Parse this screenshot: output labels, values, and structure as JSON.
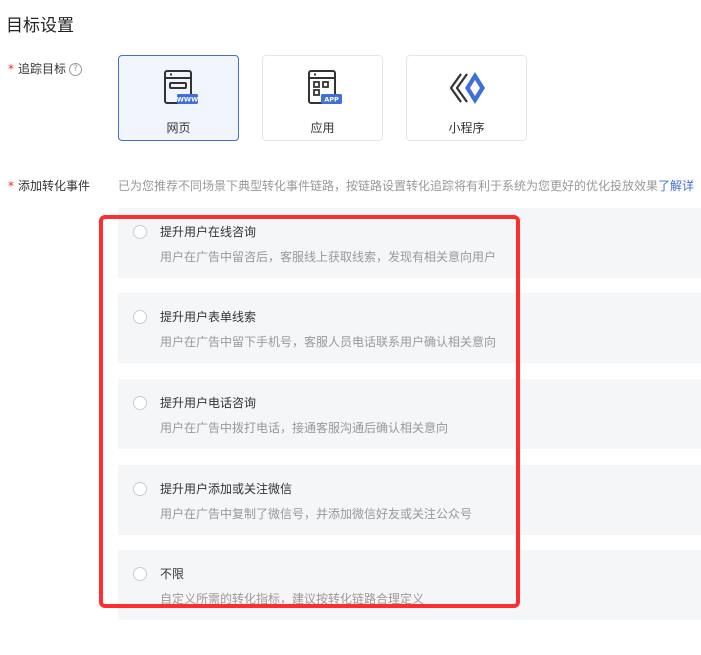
{
  "page_title": "目标设置",
  "tracking_target": {
    "label": "追踪目标",
    "help_icon": "?",
    "options": [
      {
        "label": "网页",
        "icon": "web-page-icon",
        "icon_badge": "WWW",
        "selected": true
      },
      {
        "label": "应用",
        "icon": "app-icon",
        "icon_badge": "APP",
        "selected": false
      },
      {
        "label": "小程序",
        "icon": "mini-program-icon",
        "selected": false
      }
    ]
  },
  "conversion_events": {
    "label": "添加转化事件",
    "hint": "已为您推荐不同场景下典型转化事件链路，按链路设置转化追踪将有利于系统为您更好的优化投放效果",
    "hint_link": "了解详",
    "options": [
      {
        "title": "提升用户在线咨询",
        "desc": "用户在广告中留咨后，客服线上获取线索，发现有相关意向用户"
      },
      {
        "title": "提升用户表单线索",
        "desc": "用户在广告中留下手机号，客服人员电话联系用户确认相关意向"
      },
      {
        "title": "提升用户电话咨询",
        "desc": "用户在广告中拨打电话，接通客服沟通后确认相关意向"
      },
      {
        "title": "提升用户添加或关注微信",
        "desc": "用户在广告中复制了微信号，并添加微信好友或关注公众号"
      },
      {
        "title": "不限",
        "desc": "自定义所需的转化指标，建议按转化链路合理定义"
      }
    ]
  },
  "colors": {
    "accent": "#3f6fd8",
    "highlight": "#ff2d2d",
    "required": "#f5222d"
  }
}
